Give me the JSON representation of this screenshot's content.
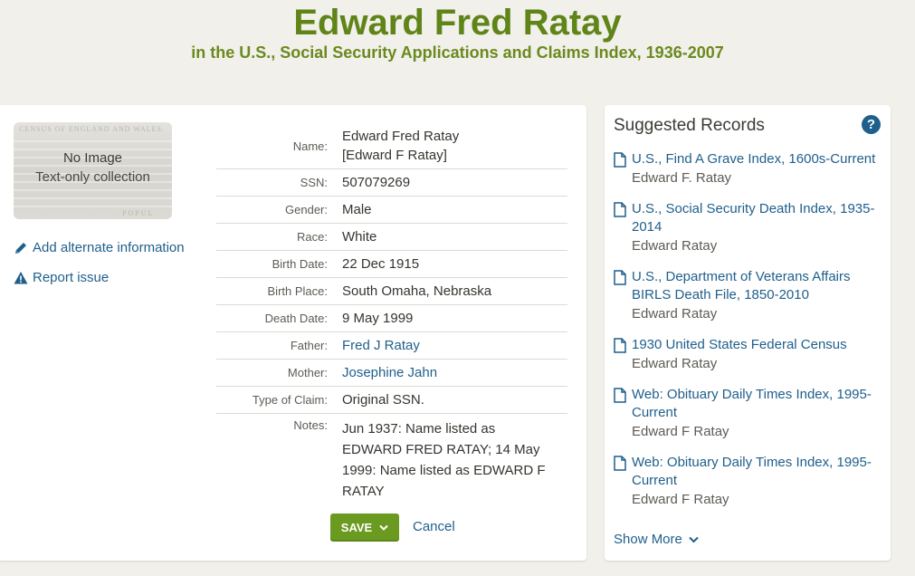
{
  "header": {
    "title": "Edward Fred Ratay",
    "subtitle": "in the U.S., Social Security Applications and Claims Index, 1936-2007"
  },
  "thumbnail": {
    "caption_line1": "No Image",
    "caption_line2": "Text-only collection",
    "bg_text_top": "CENSUS OF ENGLAND AND WALES.",
    "bg_text_bottom": "POPUL"
  },
  "actions": {
    "add_alternate": "Add alternate information",
    "report_issue": "Report issue"
  },
  "record": {
    "name_label": "Name:",
    "name_primary": "Edward Fred Ratay",
    "name_alternate": "[Edward F Ratay]",
    "rows": [
      {
        "label": "SSN:",
        "value": "507079269"
      },
      {
        "label": "Gender:",
        "value": "Male"
      },
      {
        "label": "Race:",
        "value": "White"
      },
      {
        "label": "Birth Date:",
        "value": "22 Dec 1915"
      },
      {
        "label": "Birth Place:",
        "value": "South Omaha, Nebraska"
      },
      {
        "label": "Death Date:",
        "value": "9 May 1999"
      },
      {
        "label": "Father:",
        "value": "Fred J Ratay"
      },
      {
        "label": "Mother:",
        "value": "Josephine Jahn"
      },
      {
        "label": "Type of Claim:",
        "value": "Original SSN."
      }
    ],
    "notes_label": "Notes:",
    "notes_lines": [
      "Jun 1937: Name listed as",
      "EDWARD FRED RATAY; 14 May",
      "1999: Name listed as EDWARD F",
      "RATAY"
    ]
  },
  "buttons": {
    "save": "SAVE",
    "cancel": "Cancel"
  },
  "suggested": {
    "title": "Suggested Records",
    "help": "?",
    "items": [
      {
        "title_lines": [
          "U.S., Find A Grave Index, 1600s-Current"
        ],
        "name": "Edward F. Ratay"
      },
      {
        "title_lines": [
          "U.S., Social Security Death Index, 1935-",
          "2014"
        ],
        "name": "Edward Ratay"
      },
      {
        "title_lines": [
          "U.S., Department of Veterans Affairs",
          "BIRLS Death File, 1850-2010"
        ],
        "name": "Edward Ratay"
      },
      {
        "title_lines": [
          "1930 United States Federal Census"
        ],
        "name": "Edward Ratay"
      },
      {
        "title_lines": [
          "Web: Obituary Daily Times Index, 1995-",
          "Current"
        ],
        "name": "Edward F Ratay"
      },
      {
        "title_lines": [
          "Web: Obituary Daily Times Index, 1995-",
          "Current"
        ],
        "name": "Edward F Ratay"
      }
    ],
    "show_more": "Show More"
  },
  "colors": {
    "brand_green": "#5f8418",
    "link_blue": "#1f5f8b",
    "save_green": "#6a9a1f"
  },
  "icons": {
    "add_alternate": "pencil-icon",
    "report_issue": "warning-icon",
    "record": "document-icon",
    "help": "question-icon",
    "show_more": "chevron-down-icon",
    "save_menu": "chevron-down-icon"
  }
}
